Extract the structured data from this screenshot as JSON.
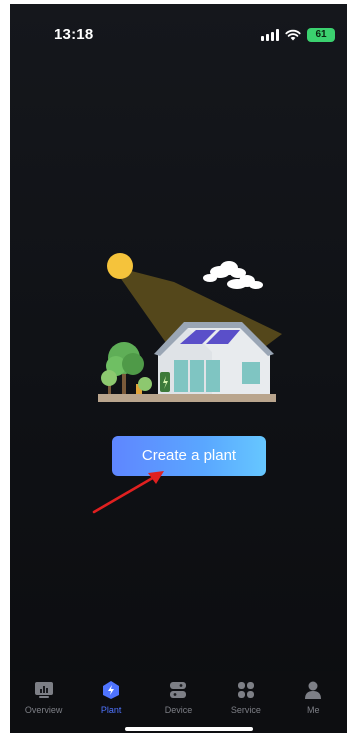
{
  "status_bar": {
    "time": "13:18",
    "battery": "61"
  },
  "main": {
    "create_button_label": "Create a plant"
  },
  "tab_bar": {
    "tabs": [
      {
        "label": "Overview",
        "icon": "chart-icon",
        "active": false
      },
      {
        "label": "Plant",
        "icon": "plant-icon",
        "active": true
      },
      {
        "label": "Device",
        "icon": "device-icon",
        "active": false
      },
      {
        "label": "Service",
        "icon": "service-icon",
        "active": false
      },
      {
        "label": "Me",
        "icon": "user-icon",
        "active": false
      }
    ]
  },
  "colors": {
    "background": "#111317",
    "accent": "#4f74ff",
    "button_gradient_start": "#5f86ff",
    "button_gradient_end": "#66c7ff",
    "annotation_arrow": "#e02020"
  }
}
